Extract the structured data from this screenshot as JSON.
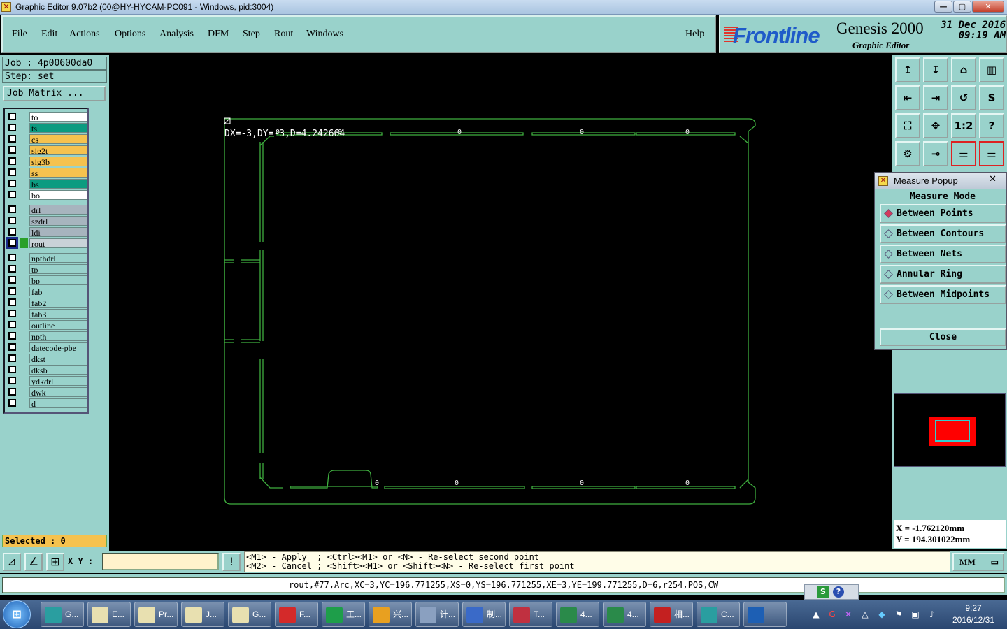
{
  "window": {
    "title": "Graphic Editor 9.07b2 (00@HY-HYCAM-PC091 - Windows, pid:3004)",
    "min": "—",
    "max": "▢",
    "close": "✕"
  },
  "menu": [
    "File",
    "Edit",
    "Actions",
    "Options",
    "Analysis",
    "DFM",
    "Step",
    "Rout",
    "Windows"
  ],
  "help": "Help",
  "logo": {
    "brand": "Frontline",
    "product": "Genesis 2000",
    "subtitle": "Graphic Editor",
    "date": "31 Dec 2016",
    "time": "09:19 AM"
  },
  "job": {
    "job": "Job : 4p00600da0",
    "step": "Step: set",
    "matrix_button": "Job Matrix ..."
  },
  "layers": [
    {
      "name": "to",
      "color": "white"
    },
    {
      "name": "ts",
      "color": "teal"
    },
    {
      "name": "cs",
      "color": "orange"
    },
    {
      "name": "sig2t",
      "color": "orange"
    },
    {
      "name": "sig3b",
      "color": "orange"
    },
    {
      "name": "ss",
      "color": "orange"
    },
    {
      "name": "bs",
      "color": "teal"
    },
    {
      "name": "bo",
      "color": "white"
    },
    {
      "name": "drl",
      "color": "grey"
    },
    {
      "name": "szdrl",
      "color": "grey"
    },
    {
      "name": "ldi",
      "color": "grey"
    },
    {
      "name": "rout",
      "color": "sel"
    },
    {
      "name": "npthdrl",
      "color": "cyan"
    },
    {
      "name": "tp",
      "color": "cyan"
    },
    {
      "name": "bp",
      "color": "cyan"
    },
    {
      "name": "fab",
      "color": "cyan"
    },
    {
      "name": "fab2",
      "color": "cyan"
    },
    {
      "name": "fab3",
      "color": "cyan"
    },
    {
      "name": "outline",
      "color": "cyan"
    },
    {
      "name": "npth",
      "color": "cyan"
    },
    {
      "name": "datecode-pbe",
      "color": "cyan"
    },
    {
      "name": "dkst",
      "color": "cyan"
    },
    {
      "name": "dksb",
      "color": "cyan"
    },
    {
      "name": "ydkdrl",
      "color": "cyan"
    },
    {
      "name": "dwk",
      "color": "cyan"
    },
    {
      "name": "d",
      "color": "cyan"
    }
  ],
  "selected": "Selected : 0",
  "canvas": {
    "measure_text": "DX=-3,DY=-3,D=4.242664",
    "line_color": "#3fae3f",
    "marker": "0"
  },
  "tools": [
    "↥",
    "↧",
    "⌂",
    "▥",
    "⇤",
    "⇥",
    "↺",
    "S",
    "⛶",
    "✥",
    "1:2",
    "?",
    "⚙",
    "⊸",
    "⚌",
    "⚌"
  ],
  "popup": {
    "title": "Measure Popup",
    "close_x": "✕",
    "mode_label": "Measure Mode",
    "options": [
      "Between Points",
      "Between Contours",
      "Between Nets",
      "Annular Ring",
      "Between Midpoints"
    ],
    "selected_option": "Between Points",
    "close_button": "Close"
  },
  "coords": {
    "x": "X = -1.762120mm",
    "y": "Y = 194.301022mm"
  },
  "bottom": {
    "xy_label": "X Y :",
    "xy_value": "",
    "hint1": "<M1> - Apply  ; <Ctrl><M1> or <N> - Re-select second point",
    "hint2": "<M2> - Cancel ; <Shift><M1> or <Shift><N> - Re-select first point",
    "units": "MM"
  },
  "status": "rout,#77,Arc,XC=3,YC=196.771255,XS=0,YS=196.771255,XE=3,YE=199.771255,D=6,r254,POS,CW",
  "taskbar": {
    "items": [
      {
        "label": "G...",
        "color": "#2a9ea0"
      },
      {
        "label": "E...",
        "color": "#e8e0b0"
      },
      {
        "label": "Pr...",
        "color": "#e8e0b0"
      },
      {
        "label": "J...",
        "color": "#e8e0b0"
      },
      {
        "label": "G...",
        "color": "#e8e0b0"
      },
      {
        "label": "F...",
        "color": "#d42a2a"
      },
      {
        "label": "工...",
        "color": "#1e9e4a"
      },
      {
        "label": "兴...",
        "color": "#e8a020"
      },
      {
        "label": "计...",
        "color": "#8aa0c0"
      },
      {
        "label": "制...",
        "color": "#3a6ac8"
      },
      {
        "label": "T...",
        "color": "#c03040"
      },
      {
        "label": "4...",
        "color": "#2a8a4a"
      },
      {
        "label": "4...",
        "color": "#2a8a4a"
      },
      {
        "label": "相...",
        "color": "#c42020"
      },
      {
        "label": "C...",
        "color": "#2a9ea0"
      },
      {
        "label": "",
        "color": "#1d5fb4"
      }
    ],
    "clock_time": "9:27",
    "clock_date": "2016/12/31"
  }
}
